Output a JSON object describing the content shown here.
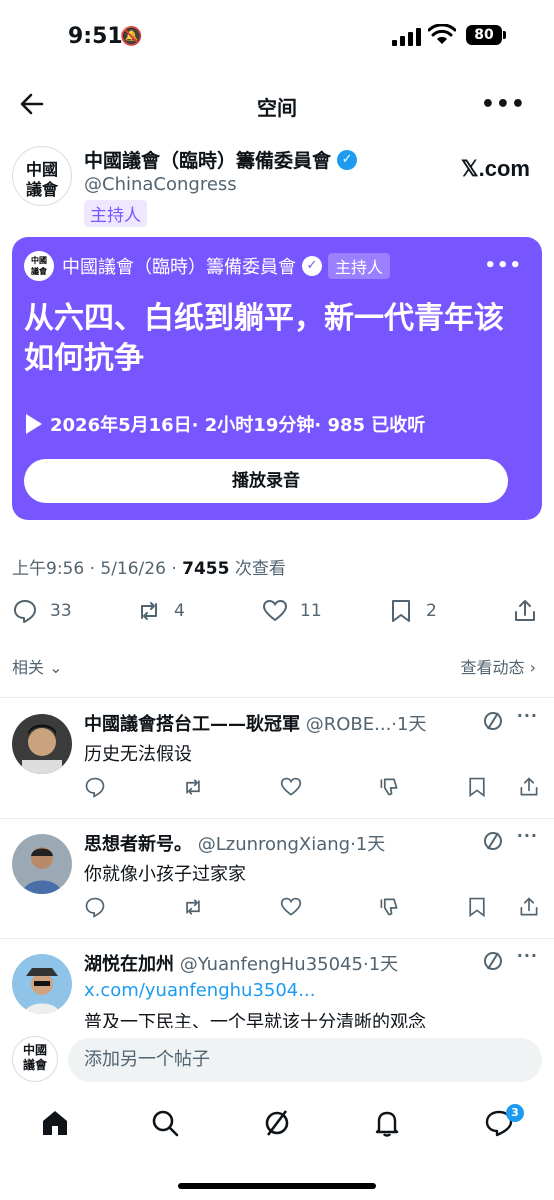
{
  "status_bar": {
    "time": "9:51",
    "battery": "80"
  },
  "nav": {
    "title": "空间"
  },
  "host": {
    "name": "中國議會（臨時）籌備委員會",
    "handle": "@ChinaCongress",
    "role": "主持人",
    "avatar_text_1": "中國",
    "avatar_text_2": "議會",
    "site": "𝕏.com"
  },
  "space_card": {
    "host_name": "中國議會（臨時）籌備委員會",
    "role": "主持人",
    "title": "从六四、白纸到躺平，新一代青年该如何抗争",
    "meta": "2026年5月16日· 2小时19分钟· 985 已收听",
    "play_button": "播放录音",
    "color": "#7856ff"
  },
  "post_meta": {
    "time_date": "上午9:56 · 5/16/26 · ",
    "views": "7455",
    "views_label": " 次查看"
  },
  "actions": {
    "replies": "33",
    "reposts": "4",
    "likes": "11",
    "bookmarks": "2"
  },
  "related": {
    "left": "相关",
    "right": "查看动态"
  },
  "replies": [
    {
      "name": "中國議會搭台工——耿冠軍",
      "handle": "@ROBE...",
      "time": "·1天",
      "text": "历史无法假设"
    },
    {
      "name": "思想者新号。",
      "handle": "@LzunrongXiang",
      "time": "·1天",
      "text": "你就像小孩子过家家"
    },
    {
      "name": "湖悦在加州",
      "handle": "@YuanfengHu35045",
      "time": "·1天",
      "link": "x.com/yuanfenghu3504...",
      "text": "普及一下民主、一个早就该十分清晰的观念"
    }
  ],
  "compose": {
    "placeholder": "添加另一个帖子"
  },
  "tabbar": {
    "messages_badge": "3"
  }
}
